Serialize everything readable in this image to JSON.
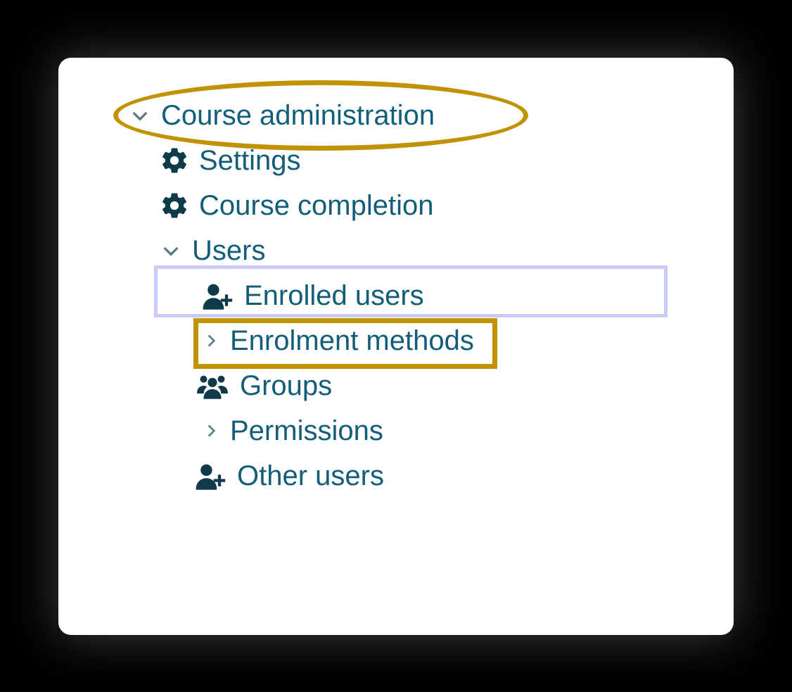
{
  "colors": {
    "link": "#125d78",
    "iconDark": "#0e3a4a",
    "annotation": "#c29205",
    "focusRing": "#c9caf6"
  },
  "nav": {
    "root": {
      "label": "Course administration",
      "expanded": true,
      "highlighted": true
    },
    "settings": {
      "label": "Settings"
    },
    "courseCompletion": {
      "label": "Course completion"
    },
    "users": {
      "label": "Users",
      "expanded": true,
      "focused": true,
      "children": {
        "enrolledUsers": {
          "label": "Enrolled users",
          "highlighted": true
        },
        "enrolmentMethods": {
          "label": "Enrolment methods",
          "expandable": true
        },
        "groups": {
          "label": "Groups"
        },
        "permissions": {
          "label": "Permissions",
          "expandable": true
        },
        "otherUsers": {
          "label": "Other users"
        }
      }
    }
  }
}
